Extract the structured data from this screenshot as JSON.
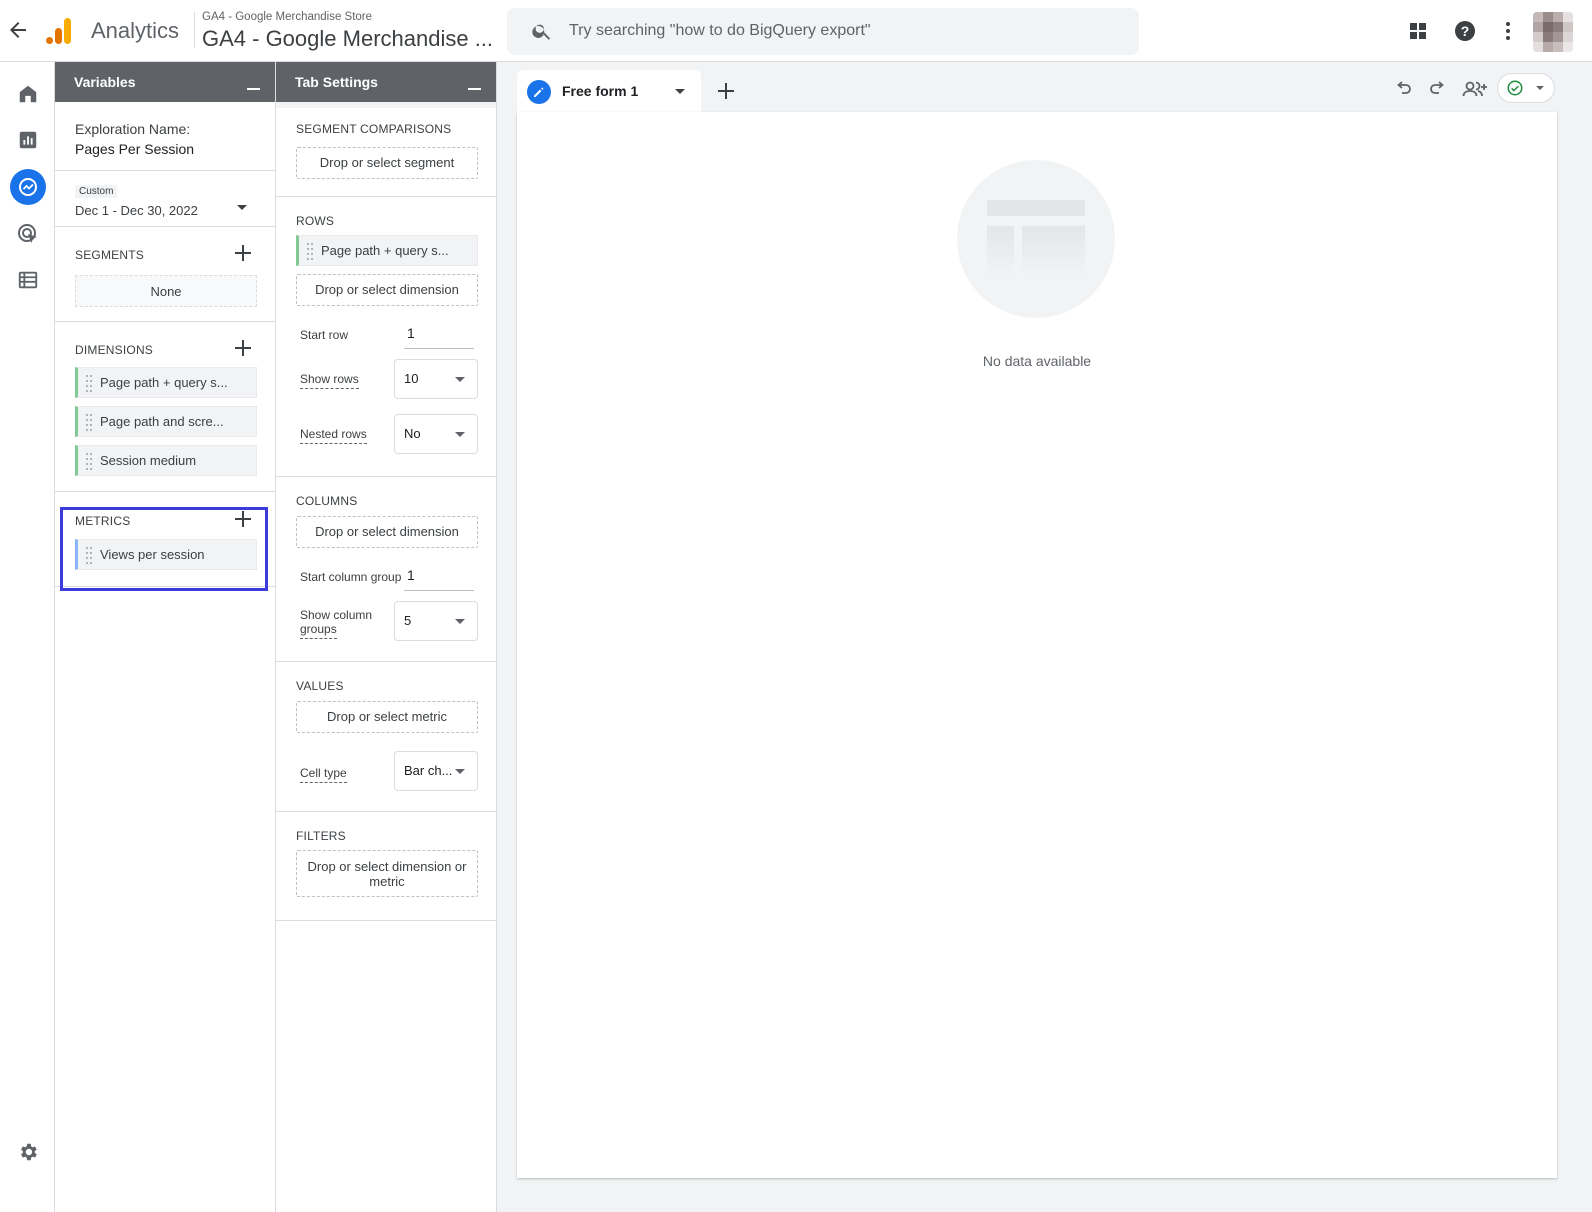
{
  "header": {
    "app_name": "Analytics",
    "account": "GA4 - Google Merchandise Store",
    "property": "GA4 - Google Merchandise ...",
    "search_placeholder": "Try searching \"how to do BigQuery export\""
  },
  "rail": {
    "items": [
      "home-icon",
      "reports-icon",
      "explore-icon",
      "advertising-icon",
      "configure-icon"
    ],
    "active": "explore-icon",
    "settings": "gear-icon"
  },
  "variables": {
    "title": "Variables",
    "exploration_label": "Exploration Name:",
    "exploration_name": "Pages Per Session",
    "date_tag": "Custom",
    "date_range": "Dec 1 - Dec 30, 2022",
    "segments_label": "SEGMENTS",
    "segments_value": "None",
    "dimensions_label": "DIMENSIONS",
    "dimensions": [
      "Page path + query s...",
      "Page path and scre...",
      "Session medium"
    ],
    "metrics_label": "METRICS",
    "metrics": [
      "Views per session"
    ]
  },
  "tab_settings": {
    "title": "Tab Settings",
    "segment_comparisons_label": "SEGMENT COMPARISONS",
    "segment_drop": "Drop or select segment",
    "rows_label": "ROWS",
    "rows_chip": "Page path + query s...",
    "rows_drop": "Drop or select dimension",
    "start_row_label": "Start row",
    "start_row": "1",
    "show_rows_label": "Show rows",
    "show_rows": "10",
    "nested_rows_label": "Nested rows",
    "nested_rows": "No",
    "columns_label": "COLUMNS",
    "columns_drop": "Drop or select dimension",
    "start_column_group_label": "Start column group",
    "start_column_group": "1",
    "show_column_groups_label_1": "Show column",
    "show_column_groups_label_2": "groups",
    "show_column_groups": "5",
    "values_label": "VALUES",
    "values_drop": "Drop or select metric",
    "cell_type_label": "Cell type",
    "cell_type": "Bar ch...",
    "filters_label": "FILTERS",
    "filters_drop_1": "Drop or select dimension or",
    "filters_drop_2": "metric"
  },
  "canvas": {
    "tab_label": "Free form 1",
    "empty_text": "No data available"
  },
  "colors": {
    "accent": "#1a73e8",
    "panel_header": "#5f6368",
    "dimension_chip": "#81c995",
    "metric_chip": "#8ab4f8",
    "highlight": "#3d3bdb",
    "status_ok": "#1e8e3e",
    "logo_orange": "#f9ab00",
    "logo_dark_orange": "#e37400"
  }
}
